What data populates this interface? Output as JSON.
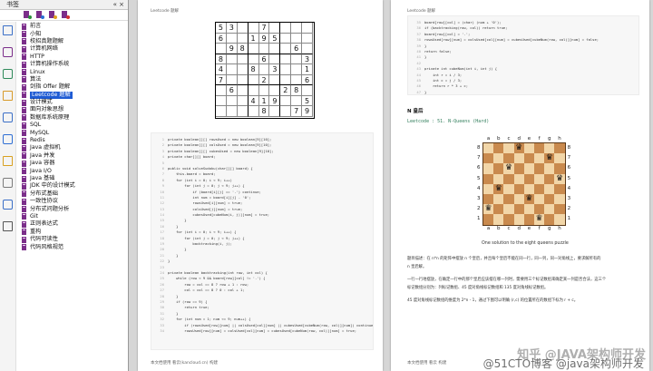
{
  "sidebar": {
    "title": "书签",
    "collapse": "«",
    "close": "×",
    "toolbar_icons": [
      "bookmark-expand-icon",
      "bookmark-collapse-icon",
      "bookmark-add-icon",
      "bookmark-delete-icon"
    ],
    "rail_icons": [
      "page-thumbnails-icon",
      "bookmarks-icon",
      "layers-icon",
      "comments-icon",
      "attachments-icon",
      "links-icon",
      "security-icon",
      "signatures-icon",
      "tools-icon",
      "settings-icon"
    ],
    "items": [
      {
        "label": "前言"
      },
      {
        "label": "小知"
      },
      {
        "label": "校招真题题解"
      },
      {
        "label": "计算机网络"
      },
      {
        "label": "HTTP"
      },
      {
        "label": "计算机操作系统"
      },
      {
        "label": "Linux"
      },
      {
        "label": "算法"
      },
      {
        "label": "剑指 Offer 题解"
      },
      {
        "label": "Leetcode 题解",
        "selected": true
      },
      {
        "label": "设计模式"
      },
      {
        "label": "面向对象思想"
      },
      {
        "label": "数据库系统原理"
      },
      {
        "label": "SQL"
      },
      {
        "label": "MySQL"
      },
      {
        "label": "Redis"
      },
      {
        "label": "Java 虚拟机"
      },
      {
        "label": "Java 并发"
      },
      {
        "label": "Java 容器"
      },
      {
        "label": "Java I/O"
      },
      {
        "label": "Java 基础"
      },
      {
        "label": "JDK 中的设计模式"
      },
      {
        "label": "分布式基础"
      },
      {
        "label": "一致性协议"
      },
      {
        "label": "分布式问题分析"
      },
      {
        "label": "Git"
      },
      {
        "label": "正则表达式"
      },
      {
        "label": "重构"
      },
      {
        "label": "代码可读性"
      },
      {
        "label": "代码风格规范"
      }
    ]
  },
  "left_page": {
    "running_head": "Leetcode 题解",
    "footer": "本文档使用 看云(kancloud.cn) 构建",
    "sudoku": [
      [
        "5",
        "3",
        "",
        "",
        "7",
        "",
        "",
        "",
        ""
      ],
      [
        "6",
        "",
        "",
        "1",
        "9",
        "5",
        "",
        "",
        ""
      ],
      [
        "",
        "9",
        "8",
        "",
        "",
        "",
        "",
        "6",
        ""
      ],
      [
        "8",
        "",
        "",
        "",
        "6",
        "",
        "",
        "",
        "3"
      ],
      [
        "4",
        "",
        "",
        "8",
        "",
        "3",
        "",
        "",
        "1"
      ],
      [
        "7",
        "",
        "",
        "",
        "2",
        "",
        "",
        "",
        "6"
      ],
      [
        "",
        "6",
        "",
        "",
        "",
        "",
        "2",
        "8",
        ""
      ],
      [
        "",
        "",
        "",
        "4",
        "1",
        "9",
        "",
        "",
        "5"
      ],
      [
        "",
        "",
        "",
        "",
        "8",
        "",
        "",
        "7",
        "9"
      ]
    ],
    "code_top": [
      "private boolean[][] rowsUsed = new boolean[9][10];",
      "private boolean[][] colsUsed = new boolean[9][10];",
      "private boolean[][] cubesUsed = new boolean[9][10];",
      "private char[][] board;",
      "",
      "public void solveSudoku(char[][] board) {",
      "    this.board = board;",
      "    for (int i = 0; i < 9; i++)",
      "        for (int j = 0; j < 9; j++) {",
      "            if (board[i][j] == '.') continue;",
      "            int num = board[i][j] - '0';",
      "            rowsUsed[i][num] = true;",
      "            colsUsed[j][num] = true;",
      "            cubesUsed[cubeNum(i, j)][num] = true;",
      "        }",
      "    }",
      "    for (int i = 0; i < 9; i++) {",
      "        for (int j = 0; j < 9; j++) {",
      "            backtracking(i, j);",
      "        }",
      "    }",
      "}",
      "",
      "private boolean backtracking(int row, int col) {",
      "    while (row < 9 && board[row][col] != '.') {",
      "        row = col == 8 ? row + 1 : row;",
      "        col = col == 8 ? 0 : col + 1;",
      "    }",
      "    if (row == 9) {",
      "        return true;",
      "    }",
      "    for (int num = 1; num <= 9; num++) {",
      "        if (rowsUsed[row][num] || colsUsed[col][num] || cubesUsed[cubeNum(row, col)][num]) continue;",
      "        rowsUsed[row][num] = colsUsed[col][num] = cubesUsed[cubeNum(row, col)][num] = true;"
    ]
  },
  "right_page": {
    "running_head": "Leetcode 题解",
    "footer": "本文档使用 看云 构建",
    "code_top": [
      "board[row][col] = (char) (num + '0');",
      "if (backtracking(row, col)) return true;",
      "board[row][col] = '.';",
      "rowsUsed[row][num] = colsUsed[col][num] = cubesUsed[cubeNum(row, col)][num] = false;",
      "}",
      "return false;",
      "}",
      "",
      "private int cubeNum(int i, int j) {",
      "    int r = i / 3;",
      "    int c = j / 3;",
      "    return r * 3 + c;",
      "}"
    ],
    "section": "N 皇后",
    "problem_link": "Leetcode : 51. N-Queens (Hard)",
    "files": [
      "a",
      "b",
      "c",
      "d",
      "e",
      "f",
      "g",
      "h"
    ],
    "ranks": [
      "8",
      "7",
      "6",
      "5",
      "4",
      "3",
      "2",
      "1"
    ],
    "queens": [
      [
        3,
        0
      ],
      [
        6,
        1
      ],
      [
        2,
        2
      ],
      [
        7,
        3
      ],
      [
        1,
        4
      ],
      [
        4,
        5
      ],
      [
        0,
        6
      ],
      [
        5,
        7
      ]
    ],
    "caption": "One solution to the eight queens puzzle",
    "paragraphs": [
      "题目描述：在 n*n 的矩阵中摆放 n 个皇后，并且每个皇后不能在同一行，同一列，同一对角线上，要求解所有的",
      "n 皇后解。",
      "",
      "一行一行地摆放，在确定一行中的那个皇后应该摆在哪一列时，需要用三个标记数组来确定某一列是否合法，这三个",
      "标记数组分别为：列标记数组、45 度对角线标记数组和 135 度对角线标记数组。",
      "",
      "45 度对角线标记数组的维度为 2*n - 1，通过下图可以明确 (r,c) 的位置所在的数组下标为 r + c。"
    ],
    "light_color": "#f2d6a8",
    "dark_color": "#c98a4e"
  },
  "watermark": "知乎 @JAVA架构师开发",
  "watermark_sub": "@51CTO博客 @java架构师开发"
}
